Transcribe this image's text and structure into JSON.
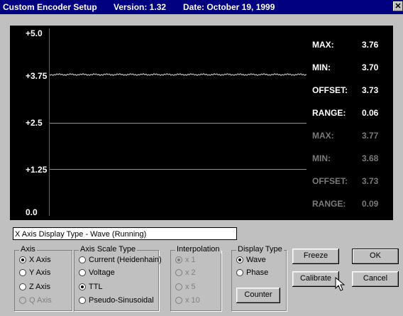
{
  "window": {
    "title": "Custom Encoder Setup",
    "version": "Version: 1.32",
    "date": "Date: October 19, 1999",
    "close_glyph": "✕"
  },
  "scope": {
    "y_labels": [
      "+5.0",
      "+3.75",
      "+2.5",
      "+1.25",
      "0.0"
    ],
    "trace_level": 3.73,
    "stats_bright": [
      {
        "label": "MAX:",
        "value": "3.76"
      },
      {
        "label": "MIN:",
        "value": "3.70"
      },
      {
        "label": "OFFSET:",
        "value": "3.73"
      },
      {
        "label": "RANGE:",
        "value": "0.06"
      }
    ],
    "stats_dim": [
      {
        "label": "MAX:",
        "value": "3.77"
      },
      {
        "label": "MIN:",
        "value": "3.68"
      },
      {
        "label": "OFFSET:",
        "value": "3.73"
      },
      {
        "label": "RANGE:",
        "value": "0.09"
      }
    ],
    "colors": {
      "bright": "#ffffff",
      "dim": "#7a7a7a",
      "background": "#000000"
    }
  },
  "status_text": "X Axis  Display Type - Wave (Running)",
  "axis_group": {
    "title": "Axis",
    "options": [
      "X Axis",
      "Y Axis",
      "Z Axis",
      "Q Axis"
    ],
    "selected": "X Axis"
  },
  "scale_group": {
    "title": "Axis Scale Type",
    "options": [
      "Current (Heidenhain)",
      "Voltage",
      "TTL",
      "Pseudo-Sinusoidal"
    ],
    "selected": "TTL"
  },
  "interp_group": {
    "title": "Interpolation",
    "options": [
      "x 1",
      "x 2",
      "x 5",
      "x 10"
    ],
    "selected": "x 1"
  },
  "display_group": {
    "title": "Display Type",
    "options": [
      "Wave",
      "Phase"
    ],
    "selected": "Wave",
    "counter_label": "Counter"
  },
  "buttons": {
    "freeze": "Freeze",
    "ok": "OK",
    "calibrate": "Calibrate",
    "cancel": "Cancel"
  }
}
